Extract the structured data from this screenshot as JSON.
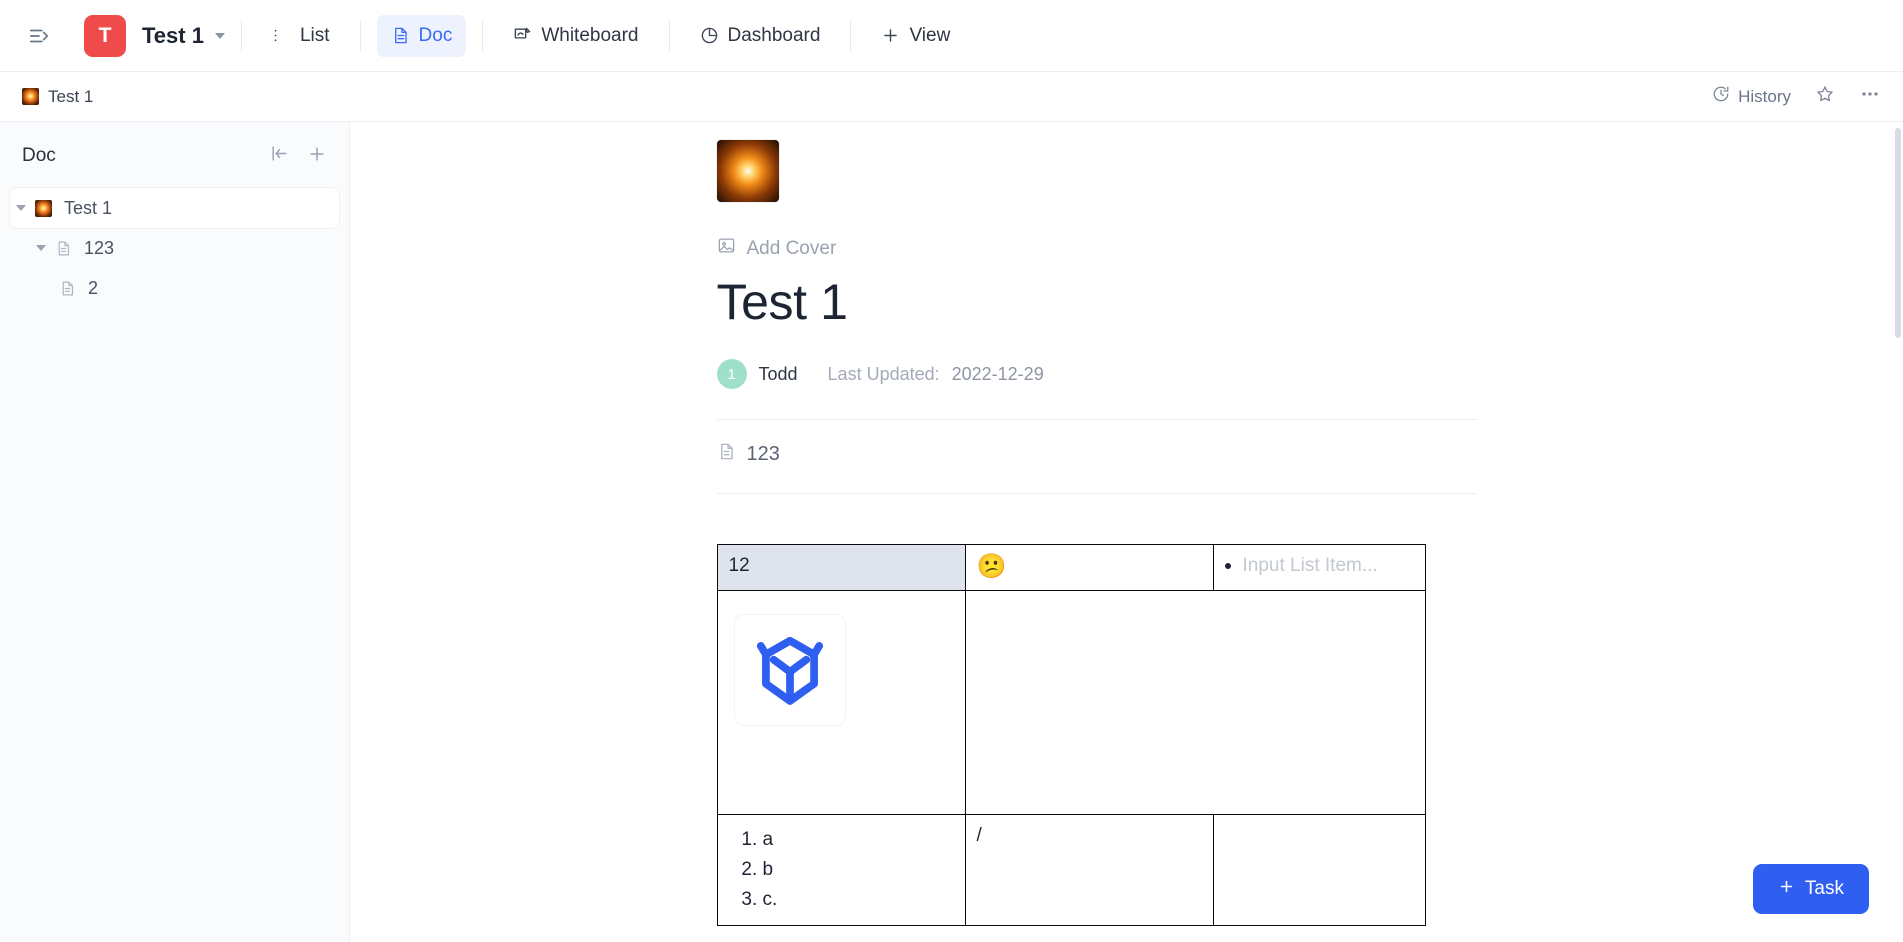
{
  "topbar": {
    "sidebar_toggle_icon": "sidebar-expand-icon",
    "space_initial": "T",
    "space_name": "Test 1",
    "space_color": "#f04b4b",
    "tabs": [
      {
        "label": "List",
        "icon": "list-icon",
        "active": false
      },
      {
        "label": "Doc",
        "icon": "doc-icon",
        "active": true
      },
      {
        "label": "Whiteboard",
        "icon": "whiteboard-icon",
        "active": false
      },
      {
        "label": "Dashboard",
        "icon": "dashboard-icon",
        "active": false
      },
      {
        "label": "View",
        "icon": "plus-icon",
        "active": false
      }
    ],
    "active_tab_color": "#3b6bf5"
  },
  "breadcrumb": {
    "items": [
      {
        "label": "Test 1",
        "icon": "firework-favicon"
      }
    ],
    "history_label": "History",
    "history_icon": "clock-history-icon",
    "star_icon": "star-icon",
    "more_icon": "ellipsis-icon"
  },
  "sidebar": {
    "title": "Doc",
    "collapse_icon": "collapse-left-icon",
    "add_icon": "plus-icon",
    "tree": [
      {
        "label": "Test 1",
        "icon": "firework-favicon",
        "level": 1,
        "expanded": true,
        "selected": true
      },
      {
        "label": "123",
        "icon": "page-icon",
        "level": 2,
        "expanded": true,
        "selected": false
      },
      {
        "label": "2",
        "icon": "page-icon",
        "level": 3,
        "expanded": false,
        "selected": false
      }
    ]
  },
  "doc": {
    "icon": "firework-doc-icon",
    "add_cover_label": "Add Cover",
    "add_cover_icon": "image-icon",
    "title": "Test 1",
    "author_initial": "1",
    "author_name": "Todd",
    "last_updated_label": "Last Updated:",
    "last_updated_value": "2022-12-29",
    "subpage": {
      "label": "123",
      "icon": "page-icon"
    },
    "table": {
      "row1": {
        "c1": "12",
        "c2_emoji": "😕",
        "c2_icon": "confused-face-emoji",
        "c3_placeholder": "Input List Item...",
        "c3_bullet_icon": "bullet-dot-icon"
      },
      "row2": {
        "c1_image_icon": "blue-cube-logo-icon",
        "c1_image_color": "#2f5ff0",
        "c2": "",
        "c3": ""
      },
      "row3": {
        "c1_list": [
          "a",
          "b",
          "c."
        ],
        "c2": "/",
        "c3": ""
      }
    }
  },
  "fab": {
    "label": "Task",
    "icon": "plus-icon",
    "color": "#2f5ff0"
  }
}
